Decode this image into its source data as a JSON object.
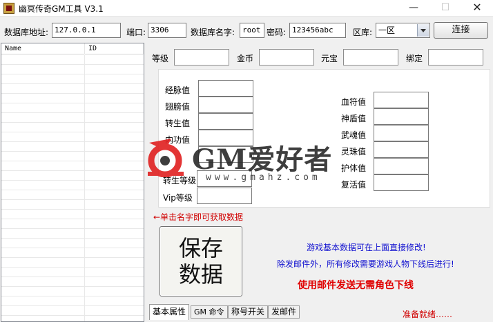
{
  "window": {
    "title": "幽冥传奇GM工具 V3.1",
    "controls": {
      "minimize": "—",
      "maximize": "☐",
      "close": "✕"
    }
  },
  "connection": {
    "db_address_label": "数据库地址:",
    "db_address_value": "127.0.0.1",
    "port_label": "端口:",
    "port_value": "3306",
    "db_name_label": "数据库名字:",
    "db_name_value": "root",
    "password_label": "密码:",
    "password_value": "123456abc",
    "zone_label": "区库:",
    "zone_value": "一区",
    "connect_label": "连接"
  },
  "list": {
    "columns": [
      "Name",
      "ID"
    ]
  },
  "basic": {
    "level_label": "等级",
    "gold_label": "金币",
    "yuanbao_label": "元宝",
    "bound_label": "绑定"
  },
  "panel": {
    "left_labels": [
      "经脉值",
      "翅膀值",
      "转生值",
      "内功值",
      "",
      "转生等级",
      "Vip等级"
    ],
    "right_labels": [
      "血符值",
      "神盾值",
      "武魂值",
      "灵珠值",
      "护体值",
      "复活值"
    ]
  },
  "watermark": {
    "brand": "GM爱好者",
    "url": "www.gmahz.com"
  },
  "hint": "←单击名字即可获取数据",
  "save_label": "保存数据",
  "info": {
    "line1": "游戏基本数据可在上面直接修改!",
    "line2": "除发邮件外，所有修改需要游戏人物下线后进行!",
    "line3": "使用邮件发送无需角色下线"
  },
  "tabs": [
    "基本属性",
    "GM 命令",
    "称号开关",
    "发邮件"
  ],
  "status": "准备就绪……",
  "colors": {
    "hint_red": "#d00000",
    "info_blue": "#1010d0",
    "info_red": "#e00000",
    "input_border": "#8c8c8c",
    "watermark_red": "#e02020"
  }
}
